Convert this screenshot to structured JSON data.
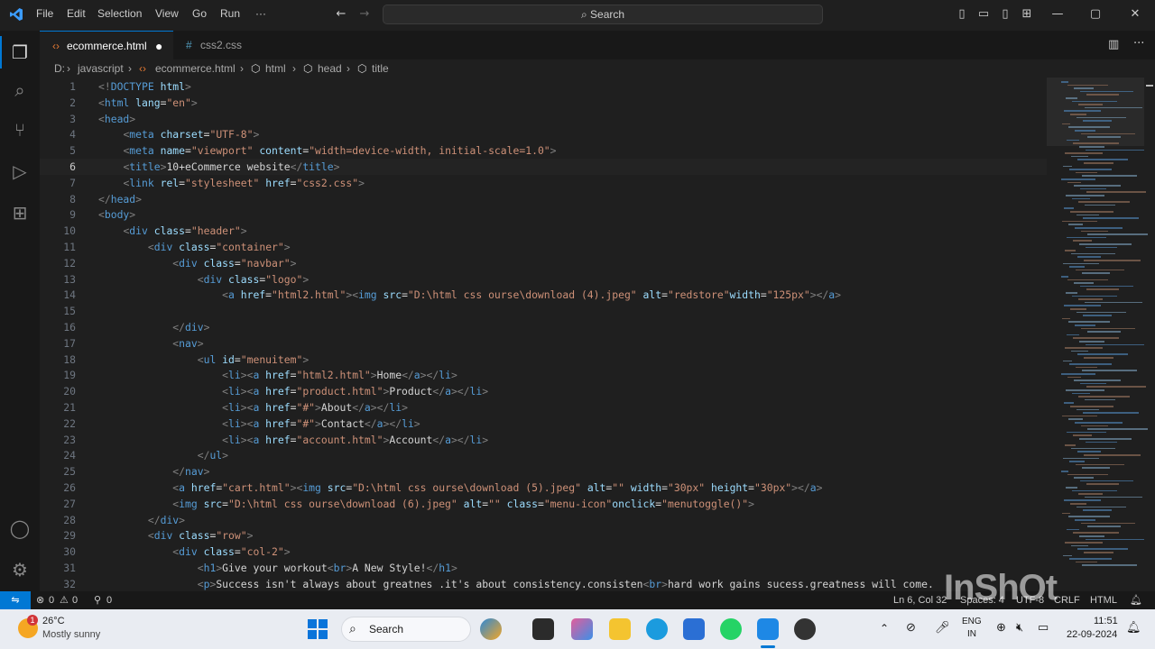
{
  "menu": {
    "file": "File",
    "edit": "Edit",
    "selection": "Selection",
    "view": "View",
    "go": "Go",
    "run": "Run",
    "more": "···"
  },
  "search": {
    "label": "Search"
  },
  "tabs": [
    {
      "label": "ecommerce.html",
      "icon": "html-file-icon",
      "active": true,
      "modified": true
    },
    {
      "label": "css2.css",
      "icon": "css-file-icon",
      "active": false,
      "modified": false
    }
  ],
  "breadcrumb": {
    "drive": "D:",
    "sep": "›",
    "folder": "javascript",
    "file": "ecommerce.html",
    "html": "html",
    "head": "head",
    "title": "title"
  },
  "code_lines": [
    {
      "n": "1",
      "parts": [
        [
          "p",
          "<!"
        ],
        [
          "t",
          "DOCTYPE"
        ],
        [
          "x",
          " "
        ],
        [
          "a",
          "html"
        ],
        [
          "p",
          ">"
        ]
      ]
    },
    {
      "n": "2",
      "parts": [
        [
          "p",
          "<"
        ],
        [
          "t",
          "html"
        ],
        [
          "x",
          " "
        ],
        [
          "a",
          "lang"
        ],
        [
          "x",
          "="
        ],
        [
          "s",
          "\"en\""
        ],
        [
          "p",
          ">"
        ]
      ]
    },
    {
      "n": "3",
      "parts": [
        [
          "p",
          "<"
        ],
        [
          "t",
          "head"
        ],
        [
          "p",
          ">"
        ]
      ]
    },
    {
      "n": "4",
      "parts": [
        [
          "x",
          "    "
        ],
        [
          "p",
          "<"
        ],
        [
          "t",
          "meta"
        ],
        [
          "x",
          " "
        ],
        [
          "a",
          "charset"
        ],
        [
          "x",
          "="
        ],
        [
          "s",
          "\"UTF-8\""
        ],
        [
          "p",
          ">"
        ]
      ]
    },
    {
      "n": "5",
      "parts": [
        [
          "x",
          "    "
        ],
        [
          "p",
          "<"
        ],
        [
          "t",
          "meta"
        ],
        [
          "x",
          " "
        ],
        [
          "a",
          "name"
        ],
        [
          "x",
          "="
        ],
        [
          "s",
          "\"viewport\""
        ],
        [
          "x",
          " "
        ],
        [
          "a",
          "content"
        ],
        [
          "x",
          "="
        ],
        [
          "s",
          "\"width=device-width, initial-scale=1.0\""
        ],
        [
          "p",
          ">"
        ]
      ]
    },
    {
      "n": "6",
      "parts": [
        [
          "x",
          "    "
        ],
        [
          "p",
          "<"
        ],
        [
          "t",
          "title"
        ],
        [
          "p",
          ">"
        ],
        [
          "x",
          "10+eCommerce website"
        ],
        [
          "p",
          "</"
        ],
        [
          "t",
          "title"
        ],
        [
          "p",
          ">"
        ]
      ]
    },
    {
      "n": "7",
      "parts": [
        [
          "x",
          "    "
        ],
        [
          "p",
          "<"
        ],
        [
          "t",
          "link"
        ],
        [
          "x",
          " "
        ],
        [
          "a",
          "rel"
        ],
        [
          "x",
          "="
        ],
        [
          "s",
          "\"stylesheet\""
        ],
        [
          "x",
          " "
        ],
        [
          "a",
          "href"
        ],
        [
          "x",
          "="
        ],
        [
          "s",
          "\"css2.css\""
        ],
        [
          "p",
          ">"
        ]
      ]
    },
    {
      "n": "8",
      "parts": [
        [
          "p",
          "</"
        ],
        [
          "t",
          "head"
        ],
        [
          "p",
          ">"
        ]
      ]
    },
    {
      "n": "9",
      "parts": [
        [
          "p",
          "<"
        ],
        [
          "t",
          "body"
        ],
        [
          "p",
          ">"
        ]
      ]
    },
    {
      "n": "10",
      "parts": [
        [
          "x",
          "    "
        ],
        [
          "p",
          "<"
        ],
        [
          "t",
          "div"
        ],
        [
          "x",
          " "
        ],
        [
          "a",
          "class"
        ],
        [
          "x",
          "="
        ],
        [
          "s",
          "\"header\""
        ],
        [
          "p",
          ">"
        ]
      ]
    },
    {
      "n": "11",
      "parts": [
        [
          "x",
          "        "
        ],
        [
          "p",
          "<"
        ],
        [
          "t",
          "div"
        ],
        [
          "x",
          " "
        ],
        [
          "a",
          "class"
        ],
        [
          "x",
          "="
        ],
        [
          "s",
          "\"container\""
        ],
        [
          "p",
          ">"
        ]
      ]
    },
    {
      "n": "12",
      "parts": [
        [
          "x",
          "            "
        ],
        [
          "p",
          "<"
        ],
        [
          "t",
          "div"
        ],
        [
          "x",
          " "
        ],
        [
          "a",
          "class"
        ],
        [
          "x",
          "="
        ],
        [
          "s",
          "\"navbar\""
        ],
        [
          "p",
          ">"
        ]
      ]
    },
    {
      "n": "13",
      "parts": [
        [
          "x",
          "                "
        ],
        [
          "p",
          "<"
        ],
        [
          "t",
          "div"
        ],
        [
          "x",
          " "
        ],
        [
          "a",
          "class"
        ],
        [
          "x",
          "="
        ],
        [
          "s",
          "\"logo\""
        ],
        [
          "p",
          ">"
        ]
      ]
    },
    {
      "n": "14",
      "parts": [
        [
          "x",
          "                    "
        ],
        [
          "p",
          "<"
        ],
        [
          "t",
          "a"
        ],
        [
          "x",
          " "
        ],
        [
          "a",
          "href"
        ],
        [
          "x",
          "="
        ],
        [
          "s",
          "\"html2.html\""
        ],
        [
          "p",
          ">"
        ],
        [
          "p",
          "<"
        ],
        [
          "t",
          "img"
        ],
        [
          "x",
          " "
        ],
        [
          "a",
          "src"
        ],
        [
          "x",
          "="
        ],
        [
          "s",
          "\"D:\\html css ourse\\download (4).jpeg\""
        ],
        [
          "x",
          " "
        ],
        [
          "a",
          "alt"
        ],
        [
          "x",
          "="
        ],
        [
          "s",
          "\"redstore\""
        ],
        [
          "a",
          "width"
        ],
        [
          "x",
          "="
        ],
        [
          "s",
          "\"125px\""
        ],
        [
          "p",
          "></"
        ],
        [
          "t",
          "a"
        ],
        [
          "p",
          ">"
        ]
      ]
    },
    {
      "n": "15",
      "parts": []
    },
    {
      "n": "16",
      "parts": [
        [
          "x",
          "            "
        ],
        [
          "p",
          "</"
        ],
        [
          "t",
          "div"
        ],
        [
          "p",
          ">"
        ]
      ]
    },
    {
      "n": "17",
      "parts": [
        [
          "x",
          "            "
        ],
        [
          "p",
          "<"
        ],
        [
          "t",
          "nav"
        ],
        [
          "p",
          ">"
        ]
      ]
    },
    {
      "n": "18",
      "parts": [
        [
          "x",
          "                "
        ],
        [
          "p",
          "<"
        ],
        [
          "t",
          "ul"
        ],
        [
          "x",
          " "
        ],
        [
          "a",
          "id"
        ],
        [
          "x",
          "="
        ],
        [
          "s",
          "\"menuitem\""
        ],
        [
          "p",
          ">"
        ]
      ]
    },
    {
      "n": "19",
      "parts": [
        [
          "x",
          "                    "
        ],
        [
          "p",
          "<"
        ],
        [
          "t",
          "li"
        ],
        [
          "p",
          "><"
        ],
        [
          "t",
          "a"
        ],
        [
          "x",
          " "
        ],
        [
          "a",
          "href"
        ],
        [
          "x",
          "="
        ],
        [
          "s",
          "\"html2.html\""
        ],
        [
          "p",
          ">"
        ],
        [
          "x",
          "Home"
        ],
        [
          "p",
          "</"
        ],
        [
          "t",
          "a"
        ],
        [
          "p",
          "></"
        ],
        [
          "t",
          "li"
        ],
        [
          "p",
          ">"
        ]
      ]
    },
    {
      "n": "20",
      "parts": [
        [
          "x",
          "                    "
        ],
        [
          "p",
          "<"
        ],
        [
          "t",
          "li"
        ],
        [
          "p",
          "><"
        ],
        [
          "t",
          "a"
        ],
        [
          "x",
          " "
        ],
        [
          "a",
          "href"
        ],
        [
          "x",
          "="
        ],
        [
          "s",
          "\"product.html\""
        ],
        [
          "p",
          ">"
        ],
        [
          "x",
          "Product"
        ],
        [
          "p",
          "</"
        ],
        [
          "t",
          "a"
        ],
        [
          "p",
          "></"
        ],
        [
          "t",
          "li"
        ],
        [
          "p",
          ">"
        ]
      ]
    },
    {
      "n": "21",
      "parts": [
        [
          "x",
          "                    "
        ],
        [
          "p",
          "<"
        ],
        [
          "t",
          "li"
        ],
        [
          "p",
          "><"
        ],
        [
          "t",
          "a"
        ],
        [
          "x",
          " "
        ],
        [
          "a",
          "href"
        ],
        [
          "x",
          "="
        ],
        [
          "s",
          "\"#\""
        ],
        [
          "p",
          ">"
        ],
        [
          "x",
          "About"
        ],
        [
          "p",
          "</"
        ],
        [
          "t",
          "a"
        ],
        [
          "p",
          "></"
        ],
        [
          "t",
          "li"
        ],
        [
          "p",
          ">"
        ]
      ]
    },
    {
      "n": "22",
      "parts": [
        [
          "x",
          "                    "
        ],
        [
          "p",
          "<"
        ],
        [
          "t",
          "li"
        ],
        [
          "p",
          "><"
        ],
        [
          "t",
          "a"
        ],
        [
          "x",
          " "
        ],
        [
          "a",
          "href"
        ],
        [
          "x",
          "="
        ],
        [
          "s",
          "\"#\""
        ],
        [
          "p",
          ">"
        ],
        [
          "x",
          "Contact"
        ],
        [
          "p",
          "</"
        ],
        [
          "t",
          "a"
        ],
        [
          "p",
          "></"
        ],
        [
          "t",
          "li"
        ],
        [
          "p",
          ">"
        ]
      ]
    },
    {
      "n": "23",
      "parts": [
        [
          "x",
          "                    "
        ],
        [
          "p",
          "<"
        ],
        [
          "t",
          "li"
        ],
        [
          "p",
          "><"
        ],
        [
          "t",
          "a"
        ],
        [
          "x",
          " "
        ],
        [
          "a",
          "href"
        ],
        [
          "x",
          "="
        ],
        [
          "s",
          "\"account.html\""
        ],
        [
          "p",
          ">"
        ],
        [
          "x",
          "Account"
        ],
        [
          "p",
          "</"
        ],
        [
          "t",
          "a"
        ],
        [
          "p",
          "></"
        ],
        [
          "t",
          "li"
        ],
        [
          "p",
          ">"
        ]
      ]
    },
    {
      "n": "24",
      "parts": [
        [
          "x",
          "                "
        ],
        [
          "p",
          "</"
        ],
        [
          "t",
          "ul"
        ],
        [
          "p",
          ">"
        ]
      ]
    },
    {
      "n": "25",
      "parts": [
        [
          "x",
          "            "
        ],
        [
          "p",
          "</"
        ],
        [
          "t",
          "nav"
        ],
        [
          "p",
          ">"
        ]
      ]
    },
    {
      "n": "26",
      "parts": [
        [
          "x",
          "            "
        ],
        [
          "p",
          "<"
        ],
        [
          "t",
          "a"
        ],
        [
          "x",
          " "
        ],
        [
          "a",
          "href"
        ],
        [
          "x",
          "="
        ],
        [
          "s",
          "\"cart.html\""
        ],
        [
          "p",
          ">"
        ],
        [
          "p",
          "<"
        ],
        [
          "t",
          "img"
        ],
        [
          "x",
          " "
        ],
        [
          "a",
          "src"
        ],
        [
          "x",
          "="
        ],
        [
          "s",
          "\"D:\\html css ourse\\download (5).jpeg\""
        ],
        [
          "x",
          " "
        ],
        [
          "a",
          "alt"
        ],
        [
          "x",
          "="
        ],
        [
          "s",
          "\"\""
        ],
        [
          "x",
          " "
        ],
        [
          "a",
          "width"
        ],
        [
          "x",
          "="
        ],
        [
          "s",
          "\"30px\""
        ],
        [
          "x",
          " "
        ],
        [
          "a",
          "height"
        ],
        [
          "x",
          "="
        ],
        [
          "s",
          "\"30px\""
        ],
        [
          "p",
          "></"
        ],
        [
          "t",
          "a"
        ],
        [
          "p",
          ">"
        ]
      ]
    },
    {
      "n": "27",
      "parts": [
        [
          "x",
          "            "
        ],
        [
          "p",
          "<"
        ],
        [
          "t",
          "img"
        ],
        [
          "x",
          " "
        ],
        [
          "a",
          "src"
        ],
        [
          "x",
          "="
        ],
        [
          "s",
          "\"D:\\html css ourse\\download (6).jpeg\""
        ],
        [
          "x",
          " "
        ],
        [
          "a",
          "alt"
        ],
        [
          "x",
          "="
        ],
        [
          "s",
          "\"\""
        ],
        [
          "x",
          " "
        ],
        [
          "a",
          "class"
        ],
        [
          "x",
          "="
        ],
        [
          "s",
          "\"menu-icon\""
        ],
        [
          "a",
          "onclick"
        ],
        [
          "x",
          "="
        ],
        [
          "s",
          "\"menutoggle()\""
        ],
        [
          "p",
          ">"
        ]
      ]
    },
    {
      "n": "28",
      "parts": [
        [
          "x",
          "        "
        ],
        [
          "p",
          "</"
        ],
        [
          "t",
          "div"
        ],
        [
          "p",
          ">"
        ]
      ]
    },
    {
      "n": "29",
      "parts": [
        [
          "x",
          "        "
        ],
        [
          "p",
          "<"
        ],
        [
          "t",
          "div"
        ],
        [
          "x",
          " "
        ],
        [
          "a",
          "class"
        ],
        [
          "x",
          "="
        ],
        [
          "s",
          "\"row\""
        ],
        [
          "p",
          ">"
        ]
      ]
    },
    {
      "n": "30",
      "parts": [
        [
          "x",
          "            "
        ],
        [
          "p",
          "<"
        ],
        [
          "t",
          "div"
        ],
        [
          "x",
          " "
        ],
        [
          "a",
          "class"
        ],
        [
          "x",
          "="
        ],
        [
          "s",
          "\"col-2\""
        ],
        [
          "p",
          ">"
        ]
      ]
    },
    {
      "n": "31",
      "parts": [
        [
          "x",
          "                "
        ],
        [
          "p",
          "<"
        ],
        [
          "t",
          "h1"
        ],
        [
          "p",
          ">"
        ],
        [
          "x",
          "Give your workout"
        ],
        [
          "p",
          "<"
        ],
        [
          "t",
          "br"
        ],
        [
          "p",
          ">"
        ],
        [
          "x",
          "A New Style!"
        ],
        [
          "p",
          "</"
        ],
        [
          "t",
          "h1"
        ],
        [
          "p",
          ">"
        ]
      ]
    },
    {
      "n": "32",
      "parts": [
        [
          "x",
          "                "
        ],
        [
          "p",
          "<"
        ],
        [
          "t",
          "p"
        ],
        [
          "p",
          ">"
        ],
        [
          "x",
          "Success isn't always about greatnes .it's about consistency.consisten"
        ],
        [
          "p",
          "<"
        ],
        [
          "t",
          "br"
        ],
        [
          "p",
          ">"
        ],
        [
          "x",
          "hard work gains sucess.greatness will come."
        ]
      ]
    }
  ],
  "status": {
    "errors": "0",
    "warnings": "0",
    "ports": "0",
    "position": "Ln 6, Col 32",
    "spaces": "Spaces: 4",
    "encoding": "UTF-8",
    "eol": "CRLF",
    "language": "HTML"
  },
  "taskbar": {
    "weather_temp": "26°C",
    "weather_desc": "Mostly sunny",
    "weather_badge": "1",
    "search": "Search",
    "lang": "ENG",
    "region": "IN",
    "time": "11:51",
    "date": "22-09-2024"
  },
  "watermark": "InShOt",
  "colors": {
    "accent": "#0078d4",
    "editor_bg": "#1f1f1f",
    "taskbar_bg": "#e9ecf2"
  }
}
